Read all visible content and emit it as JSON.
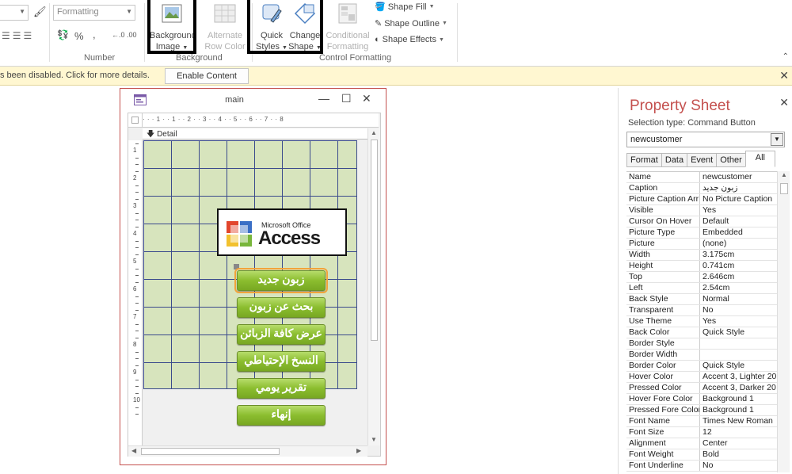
{
  "ribbon": {
    "formatting_combo": "Formatting",
    "percent": "%",
    "comma": ",",
    "inc_decimals": "←.0 .00",
    "dec_decimals": ".00 →.0",
    "number_label": "Number",
    "background_image": {
      "line1": "Background",
      "line2": "Image"
    },
    "alternate_row_color": {
      "line1": "Alternate",
      "line2": "Row Color"
    },
    "background_label": "Background",
    "quick_styles": {
      "line1": "Quick",
      "line2": "Styles"
    },
    "change_shape": {
      "line1": "Change",
      "line2": "Shape"
    },
    "conditional_formatting": {
      "line1": "Conditional",
      "line2": "Formatting"
    },
    "shape_fill": "Shape Fill",
    "shape_outline": "Shape Outline",
    "shape_effects": "Shape Effects",
    "control_formatting_label": "Control Formatting"
  },
  "message_bar": {
    "text": "s been disabled. Click for more details.",
    "enable_button": "Enable Content"
  },
  "form_window": {
    "title": "main",
    "ruler": "· · · 1 · · 1 · · 2 · · 3 · · 4 · · 5 · · 6 · · 7 · · 8",
    "section": "Detail",
    "vruler_numbers": [
      "1",
      "2",
      "3",
      "4",
      "5",
      "6",
      "7",
      "8",
      "9",
      "10"
    ],
    "logo": {
      "brand": "Microsoft Office",
      "product": "Access"
    },
    "buttons": [
      "زبون جديد",
      "بحث عن زبون",
      "عرض كافة الزبائن",
      "النسخ الإحتياطي",
      "تقرير يومي",
      "إنهاء"
    ]
  },
  "property_sheet": {
    "title": "Property Sheet",
    "selection_type": "Selection type:  Command Button",
    "object": "newcustomer",
    "tabs": [
      "Format",
      "Data",
      "Event",
      "Other",
      "All"
    ],
    "active_tab": "All",
    "rows": [
      {
        "name": "Name",
        "value": "newcustomer"
      },
      {
        "name": "Caption",
        "value": "زبون جديد"
      },
      {
        "name": "Picture Caption Arr",
        "value": "No Picture Caption"
      },
      {
        "name": "Visible",
        "value": "Yes"
      },
      {
        "name": "Cursor On Hover",
        "value": "Default"
      },
      {
        "name": "Picture Type",
        "value": "Embedded"
      },
      {
        "name": "Picture",
        "value": "(none)"
      },
      {
        "name": "Width",
        "value": "3.175cm"
      },
      {
        "name": "Height",
        "value": "0.741cm"
      },
      {
        "name": "Top",
        "value": "2.646cm"
      },
      {
        "name": "Left",
        "value": "2.54cm"
      },
      {
        "name": "Back Style",
        "value": "Normal"
      },
      {
        "name": "Transparent",
        "value": "No"
      },
      {
        "name": "Use Theme",
        "value": "Yes"
      },
      {
        "name": "Back Color",
        "value": "Quick Style"
      },
      {
        "name": "Border Style",
        "value": ""
      },
      {
        "name": "Border Width",
        "value": ""
      },
      {
        "name": "Border Color",
        "value": "Quick Style"
      },
      {
        "name": "Hover Color",
        "value": "Accent 3, Lighter 20"
      },
      {
        "name": "Pressed Color",
        "value": "Accent 3, Darker 20"
      },
      {
        "name": "Hover Fore Color",
        "value": "Background 1"
      },
      {
        "name": "Pressed Fore Color",
        "value": "Background 1"
      },
      {
        "name": "Font Name",
        "value": "Times New Roman"
      },
      {
        "name": "Font Size",
        "value": "12"
      },
      {
        "name": "Alignment",
        "value": "Center"
      },
      {
        "name": "Font Weight",
        "value": "Bold"
      },
      {
        "name": "Font Underline",
        "value": "No"
      }
    ]
  },
  "colors": {
    "accent": "#c4504e",
    "grid_fill": "#d7e4bd",
    "button_green": "#8bbd2f",
    "highlight": "#000000"
  }
}
